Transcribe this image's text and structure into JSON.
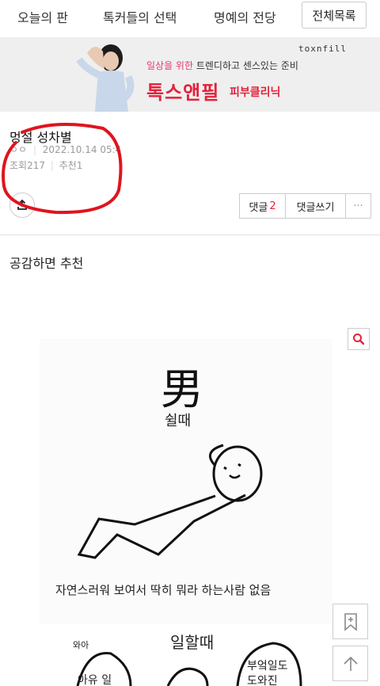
{
  "nav": {
    "tabs": [
      "오늘의 판",
      "톡커들의 선택",
      "명예의 전당"
    ],
    "all_list_label": "전체목록"
  },
  "banner": {
    "brand": "toxnfill",
    "tagline_highlight": "일상을 위한",
    "tagline_rest": " 트렌디하고 센스있는 준비",
    "title": "톡스앤필",
    "subtitle": "피부클리닉"
  },
  "post": {
    "title": "멍설 성차별",
    "author": "ㅇㅇ",
    "date": "2022.10.14 05:4",
    "views_label": "조회217",
    "recommend_label": "추천1"
  },
  "actions": {
    "comment_label": "댓글",
    "comment_count": "2",
    "write_comment_label": "댓글쓰기",
    "more_label": "···"
  },
  "body": {
    "intro": "공감하면 추천"
  },
  "comic": {
    "char_male": "男",
    "rest_label": "쉴때",
    "caption": "자연스러워 보여서 딱히 뭐라 하는사람 없음",
    "work_label": "일할때",
    "wow": "와아",
    "aigo": "아유 일",
    "bottom_right_1": "부엌일도",
    "bottom_right_2": "도와진"
  },
  "colors": {
    "accent_red": "#e3223b",
    "pink": "#e83a6d",
    "annotation_red": "#e0141e"
  }
}
